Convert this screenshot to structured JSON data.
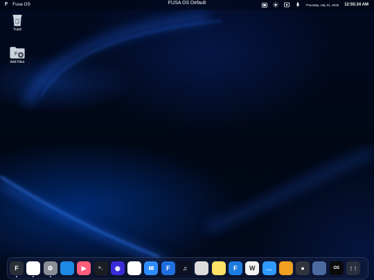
{
  "topbar": {
    "logo": "F",
    "app_name": "Fusa OS",
    "title": "FUSA OS Default",
    "date": "Thursday, July 31, 2025",
    "time": "12:55:34 AM",
    "status_icons": [
      "screen-icon",
      "brightness-icon",
      "display-icon",
      "microphone-icon"
    ]
  },
  "desktop": {
    "icons": [
      {
        "label": "Trash",
        "icon": "trash-icon"
      },
      {
        "label": "Add Files",
        "icon": "add-files-icon"
      }
    ]
  },
  "dock": {
    "apps": [
      {
        "name": "fusa-settings",
        "glyph": "F",
        "color": "#2b2f3a"
      },
      {
        "name": "photos",
        "glyph": "",
        "color": "#ffffff"
      },
      {
        "name": "system-settings",
        "glyph": "⚙",
        "color": "#8a8d96"
      },
      {
        "name": "browser",
        "glyph": "",
        "color": "#1e88e5"
      },
      {
        "name": "media-player",
        "glyph": "▶",
        "color": "#ff5d7a"
      },
      {
        "name": "terminal",
        "glyph": ">_",
        "color": "#1b1d22"
      },
      {
        "name": "podcasts",
        "glyph": "◉",
        "color": "#3a2bd9"
      },
      {
        "name": "maps",
        "glyph": "",
        "color": "#ffffff"
      },
      {
        "name": "mail",
        "glyph": "✉",
        "color": "#2f8cff"
      },
      {
        "name": "file-manager",
        "glyph": "F",
        "color": "#1f6fe0"
      },
      {
        "name": "music",
        "glyph": "♫",
        "color": "#0c1020"
      },
      {
        "name": "calculator",
        "glyph": "",
        "color": "#dcdcdc"
      },
      {
        "name": "notes",
        "glyph": "",
        "color": "#ffe066"
      },
      {
        "name": "fusa-docs",
        "glyph": "F",
        "color": "#1e7ce0"
      },
      {
        "name": "wikipedia",
        "glyph": "W",
        "color": "#f2f2f2"
      },
      {
        "name": "messages",
        "glyph": "…",
        "color": "#2f9bff"
      },
      {
        "name": "notepad",
        "glyph": "",
        "color": "#f0a020"
      },
      {
        "name": "camera",
        "glyph": "●",
        "color": "#30343c"
      },
      {
        "name": "screen-viewer",
        "glyph": "",
        "color": "#4a6aa0"
      },
      {
        "name": "fusa-os",
        "glyph": "OS",
        "color": "#0b0b0b"
      },
      {
        "name": "app-grid",
        "glyph": "⋮⋮",
        "color": "#2a2f40"
      }
    ]
  },
  "colors": {
    "background": "#010614",
    "accent_glow": "#1e6bff"
  }
}
